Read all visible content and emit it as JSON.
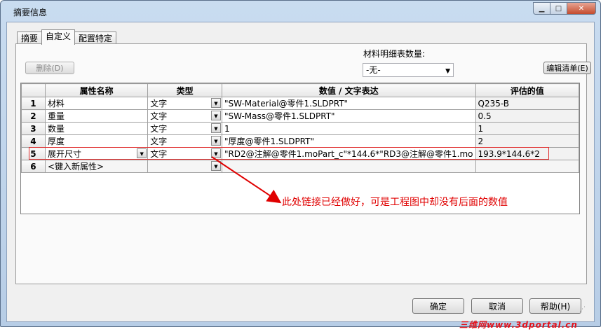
{
  "window": {
    "title": "摘要信息",
    "min_glyph": "▁",
    "max_glyph": "□",
    "close_glyph": "✕"
  },
  "tabs": [
    {
      "label": "摘要"
    },
    {
      "label": "自定义"
    },
    {
      "label": "配置特定"
    }
  ],
  "toolbar": {
    "delete_label": "删除(D)",
    "bom_qty_label": "材料明细表数量:",
    "bom_qty_value": "-无-",
    "edit_list_label": "编辑清单(E)"
  },
  "grid": {
    "columns": [
      "",
      "属性名称",
      "类型",
      "数值 / 文字表达",
      "评估的值"
    ],
    "rows": [
      {
        "num": "1",
        "name": "材料",
        "type": "文字",
        "expr": "\"SW-Material@零件1.SLDPRT\"",
        "value": "Q235-B"
      },
      {
        "num": "2",
        "name": "重量",
        "type": "文字",
        "expr": "\"SW-Mass@零件1.SLDPRT\"",
        "value": "0.5"
      },
      {
        "num": "3",
        "name": "数量",
        "type": "文字",
        "expr": "1",
        "value": "1"
      },
      {
        "num": "4",
        "name": "厚度",
        "type": "文字",
        "expr": "\"厚度@零件1.SLDPRT\"",
        "value": "2"
      },
      {
        "num": "5",
        "name": "展开尺寸",
        "type": "文字",
        "expr": "\"RD2@注解@零件1.moPart_c\"*144.6*\"RD3@注解@零件1.mo",
        "value": "193.9*144.6*2"
      },
      {
        "num": "6",
        "name": "<键入新属性>",
        "type": "",
        "expr": "",
        "value": ""
      }
    ]
  },
  "annotation": {
    "text": "此处链接已经做好，可是工程图中却没有后面的数值",
    "color": "#e00000"
  },
  "buttons": {
    "ok": "确定",
    "cancel": "取消",
    "help": "帮助(H)"
  },
  "watermark": "三维网www.3dportal.cn"
}
